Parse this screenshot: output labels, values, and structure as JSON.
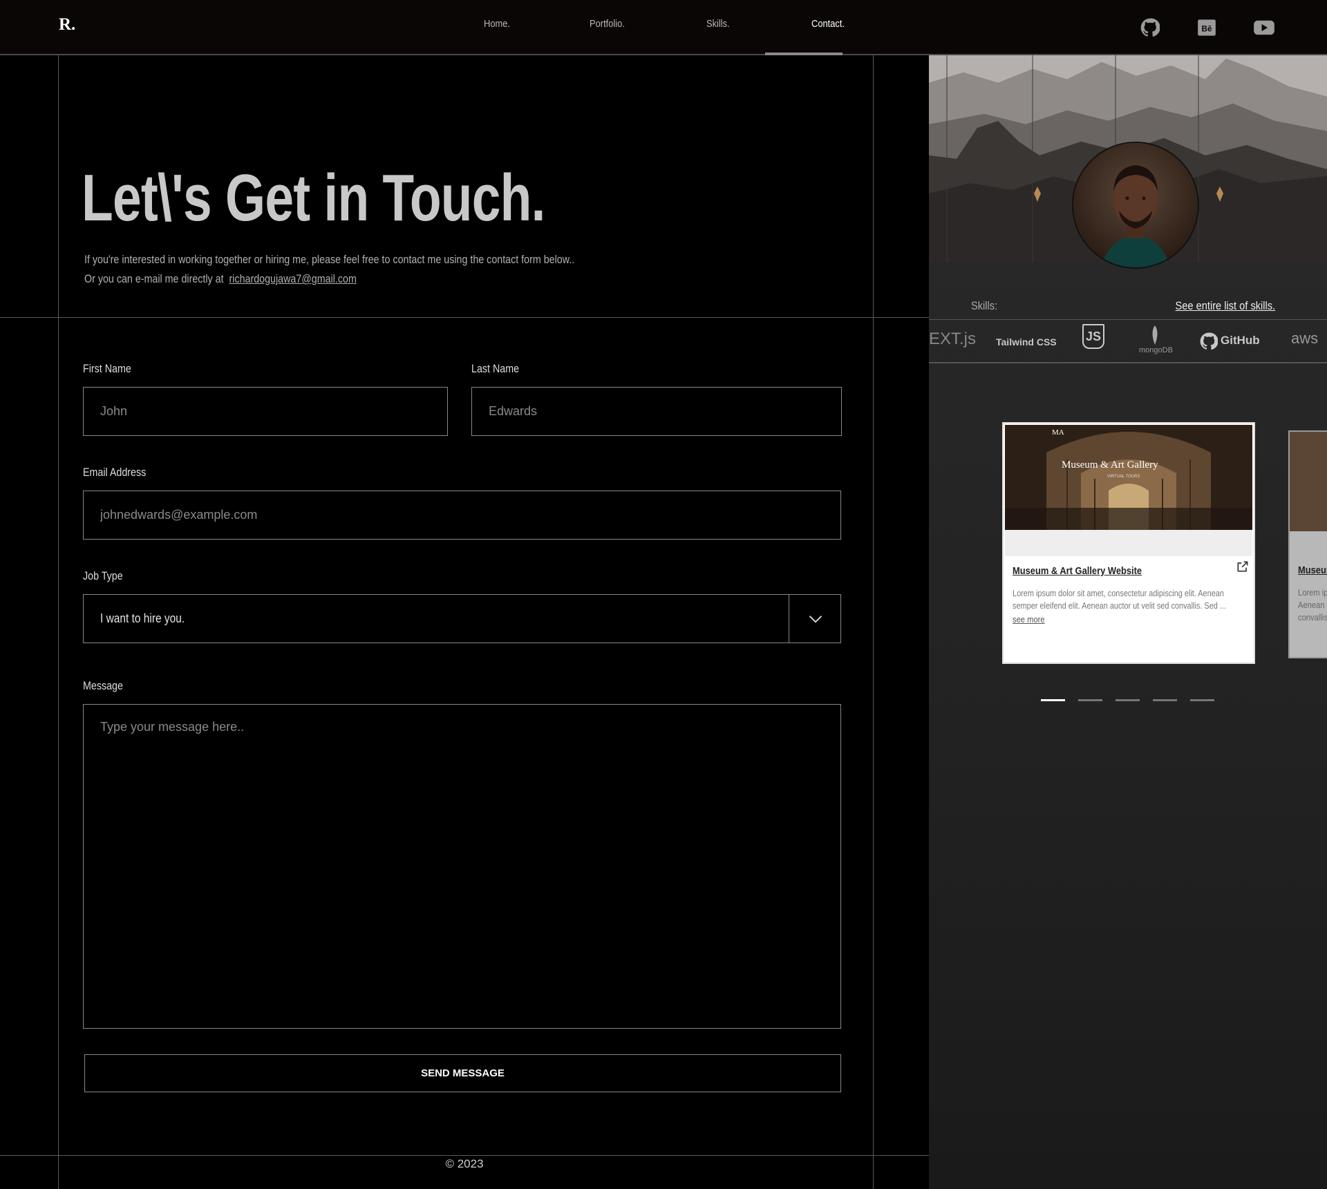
{
  "nav": {
    "logo": "R.",
    "items": [
      "Home.",
      "Portfolio.",
      "Skills.",
      "Contact."
    ],
    "active_index": 3,
    "social_icons": [
      "github-icon",
      "behance-icon",
      "youtube-icon"
    ]
  },
  "hero": {
    "title": "Let\\'s Get in Touch.",
    "line1": "If you're interested in working together or hiring me, please feel free to contact me using the contact form below..",
    "line2_prefix": "Or you can e-mail me directly at",
    "email": "richardogujawa7@gmail.com"
  },
  "form": {
    "first_name": {
      "label": "First Name",
      "placeholder": "John"
    },
    "last_name": {
      "label": "Last Name",
      "placeholder": "Edwards"
    },
    "email": {
      "label": "Email Address",
      "placeholder": "johnedwards@example.com"
    },
    "job_type": {
      "label": "Job Type",
      "value": "I want to hire you."
    },
    "message": {
      "label": "Message",
      "placeholder": "Type your message here.."
    },
    "submit_label": "SEND MESSAGE"
  },
  "footer": {
    "text": "© 2023"
  },
  "sidebar": {
    "skills_label": "Skills:",
    "skills_link": "See entire list of skills.",
    "skills": [
      "EXT.js",
      "Tailwind CSS",
      "JS",
      "mongoDB",
      "GitHub",
      "aws"
    ],
    "card": {
      "image_title": "Museum & Art Gallery",
      "image_subtitle": "VIRTUAL TOURS",
      "image_logo": "MA",
      "title": "Museum & Art Gallery Website",
      "description": "Lorem ipsum dolor sit amet, consectetur adipiscing elit. Aenean semper eleifend elit. Aenean auctor ut velit sed convallis. Sed ...",
      "see_more": "see more"
    },
    "card2": {
      "title": "Museum",
      "description": "Lorem ip Aenean s convallis"
    },
    "carousel_dots": 5,
    "carousel_active": 0
  },
  "colors": {
    "background": "#000000",
    "nav_bg": "#0a0605",
    "border": "#888888",
    "accent": "#ffffff"
  }
}
